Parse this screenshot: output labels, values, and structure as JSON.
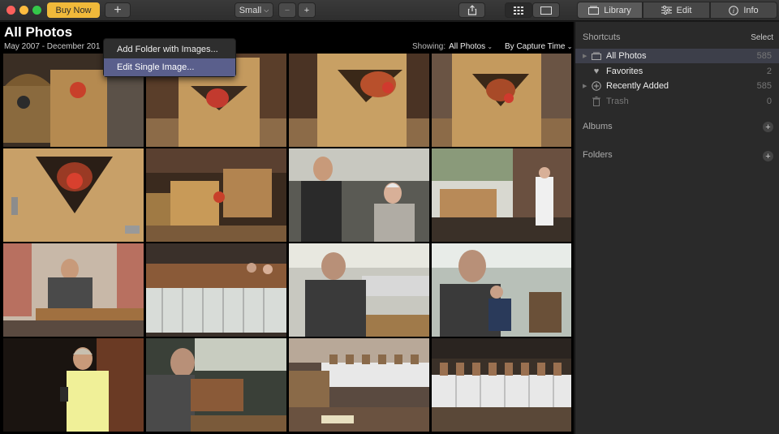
{
  "toolbar": {
    "buy_label": "Buy Now",
    "add_symbol": "+",
    "size_label": "Small",
    "zoom_out_symbol": "−",
    "zoom_in_symbol": "+",
    "tabs": [
      {
        "label": "Library",
        "icon": "library-icon"
      },
      {
        "label": "Edit",
        "icon": "sliders-icon"
      },
      {
        "label": "Info",
        "icon": "info-icon"
      }
    ]
  },
  "add_menu": {
    "items": [
      "Add Folder with Images...",
      "Edit Single Image..."
    ],
    "active_index": 1
  },
  "main": {
    "title": "All Photos",
    "date_range": "May 2007 - December 201",
    "showing_label": "Showing:",
    "showing_value": "All Photos",
    "sort_label": "By Capture Time"
  },
  "sidebar": {
    "shortcuts_title": "Shortcuts",
    "select_label": "Select",
    "items": [
      {
        "label": "All Photos",
        "count": "585",
        "icon": "photos-icon"
      },
      {
        "label": "Favorites",
        "count": "2",
        "icon": "heart-icon"
      },
      {
        "label": "Recently Added",
        "count": "585",
        "icon": "plus-circle-icon"
      },
      {
        "label": "Trash",
        "count": "0",
        "icon": "trash-icon"
      }
    ],
    "albums_title": "Albums",
    "folders_title": "Folders"
  },
  "colors": {
    "accent_buy": "#f0b93a",
    "menu_highlight": "#5a5f8c",
    "sidebar_selection": "#3d3f4a"
  },
  "thumbnails": [
    {
      "icon": "photo-rooster-basket"
    },
    {
      "icon": "photo-rooster-box"
    },
    {
      "icon": "photo-rooster-box"
    },
    {
      "icon": "photo-rooster-box"
    },
    {
      "icon": "photo-rooster-closeup"
    },
    {
      "icon": "photo-crates"
    },
    {
      "icon": "photo-men-talking"
    },
    {
      "icon": "photo-hall"
    },
    {
      "icon": "photo-man-seated"
    },
    {
      "icon": "photo-shelves"
    },
    {
      "icon": "photo-man-writing"
    },
    {
      "icon": "photo-man-writing"
    },
    {
      "icon": "photo-woman-phone"
    },
    {
      "icon": "photo-man-writing"
    },
    {
      "icon": "photo-boxes-row"
    },
    {
      "icon": "photo-boxes-row"
    }
  ]
}
